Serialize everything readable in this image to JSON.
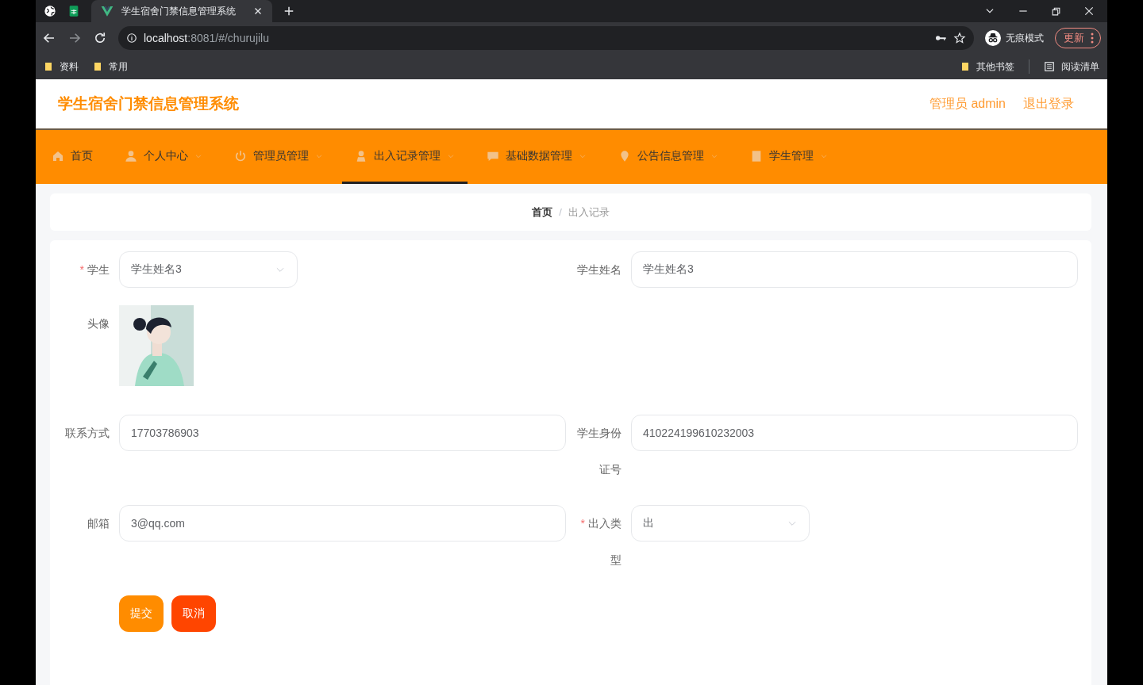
{
  "browser": {
    "tabs": [
      {
        "title": "学生宿舍门禁信息管理系统",
        "selected": true
      }
    ],
    "url_host": "localhost",
    "url_path": ":8081/#/churujilu",
    "profile_label": "无痕模式",
    "update_button": "更新",
    "bookmarks": [
      "资料",
      "常用"
    ],
    "right_bookmarks": [
      {
        "kind": "folder",
        "label": "其他书签"
      },
      {
        "kind": "reading-list",
        "label": "阅读清单"
      }
    ]
  },
  "header": {
    "title": "学生宿舍门禁信息管理系统",
    "user_label": "管理员 admin",
    "logout": "退出登录"
  },
  "nav": [
    {
      "label": "首页",
      "dropdown": false,
      "selected": false
    },
    {
      "label": "个人中心",
      "dropdown": true,
      "selected": false
    },
    {
      "label": "管理员管理",
      "dropdown": true,
      "selected": false
    },
    {
      "label": "出入记录管理",
      "dropdown": true,
      "selected": true
    },
    {
      "label": "基础数据管理",
      "dropdown": true,
      "selected": false
    },
    {
      "label": "公告信息管理",
      "dropdown": true,
      "selected": false
    },
    {
      "label": "学生管理",
      "dropdown": true,
      "selected": false
    }
  ],
  "breadcrumb": [
    "首页",
    "出入记录"
  ],
  "breadcrumb_separator": "/",
  "form": {
    "required_mark": "*",
    "rows": [
      [
        {
          "kind": "select",
          "label": "学生",
          "required": true,
          "value": "学生姓名3"
        },
        {
          "kind": "input",
          "label": "学生姓名",
          "required": false,
          "value": "学生姓名3"
        }
      ],
      [
        {
          "label": "头像",
          "required": false
        }
      ],
      [
        {
          "kind": "input",
          "label": "联系方式",
          "required": false,
          "value": "17703786903"
        },
        {
          "kind": "input",
          "label": "学生身份证号",
          "required": false,
          "value": "410224199610232003"
        }
      ],
      [
        {
          "kind": "input",
          "label": "邮箱",
          "required": false,
          "value": "3@qq.com"
        },
        {
          "kind": "select",
          "label": "出入类型",
          "required": true,
          "value": "出"
        }
      ]
    ],
    "buttons": [
      {
        "kind": "primary",
        "label": "提交"
      },
      {
        "kind": "danger",
        "label": "取消"
      }
    ]
  }
}
